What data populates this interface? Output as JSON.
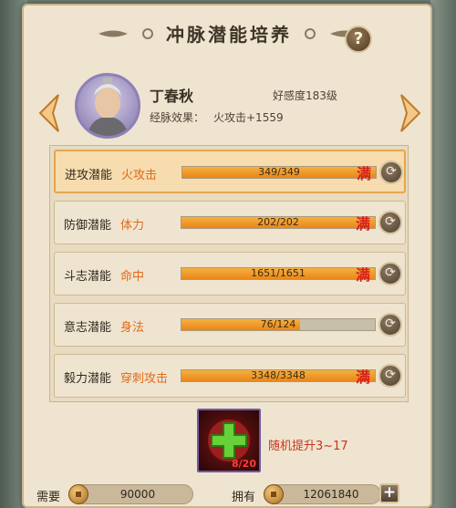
{
  "header": {
    "title": "冲脉潜能培养",
    "help_label": "?"
  },
  "character": {
    "name": "丁春秋",
    "favor": "好感度183级",
    "effect_label": "经脉效果：",
    "effect_value": "火攻击+1559"
  },
  "potentials": [
    {
      "label": "进攻潜能",
      "attr": "火攻击",
      "progress_text": "349/349",
      "current": 349,
      "max": 349,
      "full_label": "满",
      "selected": true
    },
    {
      "label": "防御潜能",
      "attr": "体力",
      "progress_text": "202/202",
      "current": 202,
      "max": 202,
      "full_label": "满",
      "selected": false
    },
    {
      "label": "斗志潜能",
      "attr": "命中",
      "progress_text": "1651/1651",
      "current": 1651,
      "max": 1651,
      "full_label": "满",
      "selected": false
    },
    {
      "label": "意志潜能",
      "attr": "身法",
      "progress_text": "76/124",
      "current": 76,
      "max": 124,
      "full_label": "",
      "selected": false
    },
    {
      "label": "毅力潜能",
      "attr": "穿刺攻击",
      "progress_text": "3348/3348",
      "current": 3348,
      "max": 3348,
      "full_label": "满",
      "selected": false
    }
  ],
  "item": {
    "count": "8/20",
    "effect": "随机提升3~17"
  },
  "cost": {
    "need_label": "需要",
    "need_value": "90000",
    "have_label": "拥有",
    "have_value": "12061840",
    "add_label": "+"
  },
  "colors": {
    "attr_orange": "#e06a1a",
    "full_red": "#d8201c",
    "bar_fill": "#f0a030",
    "panel_bg": "#efe4cf"
  },
  "icons": {
    "help": "question-icon",
    "prev": "chevron-left-icon",
    "next": "chevron-right-icon",
    "refresh": "refresh-icon",
    "item": "plus-potion-icon",
    "coin": "coin-icon"
  }
}
